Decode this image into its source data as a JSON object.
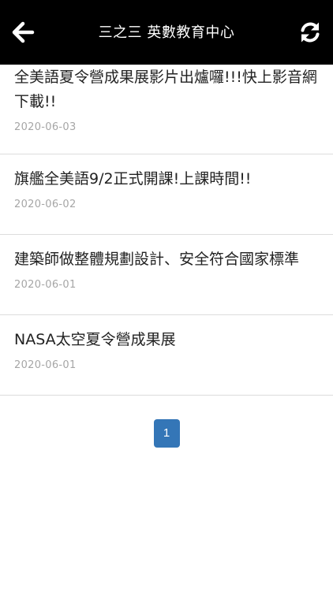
{
  "header": {
    "title": "三之三 英數教育中心",
    "back_icon": "arrow-left-icon",
    "refresh_icon": "refresh-icon"
  },
  "articles": [
    {
      "title": "全美語夏令營成果展影片出爐囉!!!快上影音網下載!!",
      "date": "2020-06-03"
    },
    {
      "title": "旗艦全美語9/2正式開課!上課時間!!",
      "date": "2020-06-02"
    },
    {
      "title": "建築師做整體規劃設計、安全符合國家標準",
      "date": "2020-06-01"
    },
    {
      "title": "NASA太空夏令營成果展",
      "date": "2020-06-01"
    }
  ],
  "pagination": {
    "current_page": "1",
    "active_color": "#3476b7"
  },
  "colors": {
    "header_bg": "#000000",
    "divider": "#dcdcdc",
    "date_text": "#a6a6a6"
  }
}
